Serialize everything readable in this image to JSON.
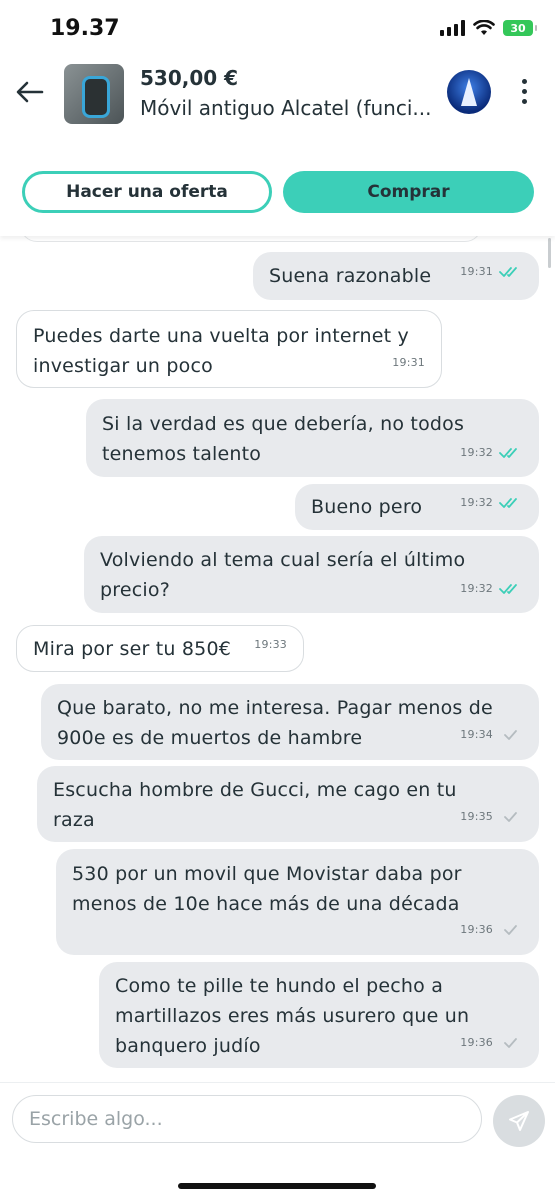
{
  "status": {
    "time": "19.37",
    "battery": "30"
  },
  "header": {
    "back_icon": "arrow-left-icon",
    "price": "530,00 €",
    "title": "Móvil antiguo Alcatel (funci...",
    "more_icon": "more-vertical-icon"
  },
  "actions": {
    "offer_label": "Hacer una oferta",
    "buy_label": "Comprar"
  },
  "messages": [
    {
      "side": "sent",
      "text": "Suena razonable",
      "time": "19:31",
      "ticks": "read"
    },
    {
      "side": "recv",
      "text": "Puedes darte una vuelta por internet y investigar un poco",
      "time": "19:31"
    },
    {
      "side": "sent",
      "text": "Si la verdad es que debería, no todos tenemos talento",
      "time": "19:32",
      "ticks": "read"
    },
    {
      "side": "sent",
      "text": "Bueno pero",
      "time": "19:32",
      "ticks": "read"
    },
    {
      "side": "sent",
      "text": "Volviendo al tema cual sería el último precio?",
      "time": "19:32",
      "ticks": "read"
    },
    {
      "side": "recv",
      "text": "Mira por ser tu 850€",
      "time": "19:33"
    },
    {
      "side": "sent",
      "text": "Que barato, no me interesa. Pagar menos de 900e es de muertos de hambre",
      "time": "19:34",
      "ticks": "sent"
    },
    {
      "side": "sent",
      "text": "Escucha hombre de Gucci, me cago en tu raza",
      "time": "19:35",
      "ticks": "sent"
    },
    {
      "side": "sent",
      "text": "530 por un movil que Movistar daba por menos de 10e hace más de una década",
      "time": "19:36",
      "ticks": "sent"
    },
    {
      "side": "sent",
      "text": "Como te pille te hundo el pecho a martillazos eres más usurero que un banquero judío",
      "time": "19:36",
      "ticks": "sent"
    }
  ],
  "composer": {
    "placeholder": "Escribe algo...",
    "send_icon": "send-icon"
  },
  "colors": {
    "accent": "#3ccfb8",
    "read_tick": "#3ccfb8",
    "sent_tick": "#b5bcc0",
    "sent_bubble": "#e8eaed"
  }
}
